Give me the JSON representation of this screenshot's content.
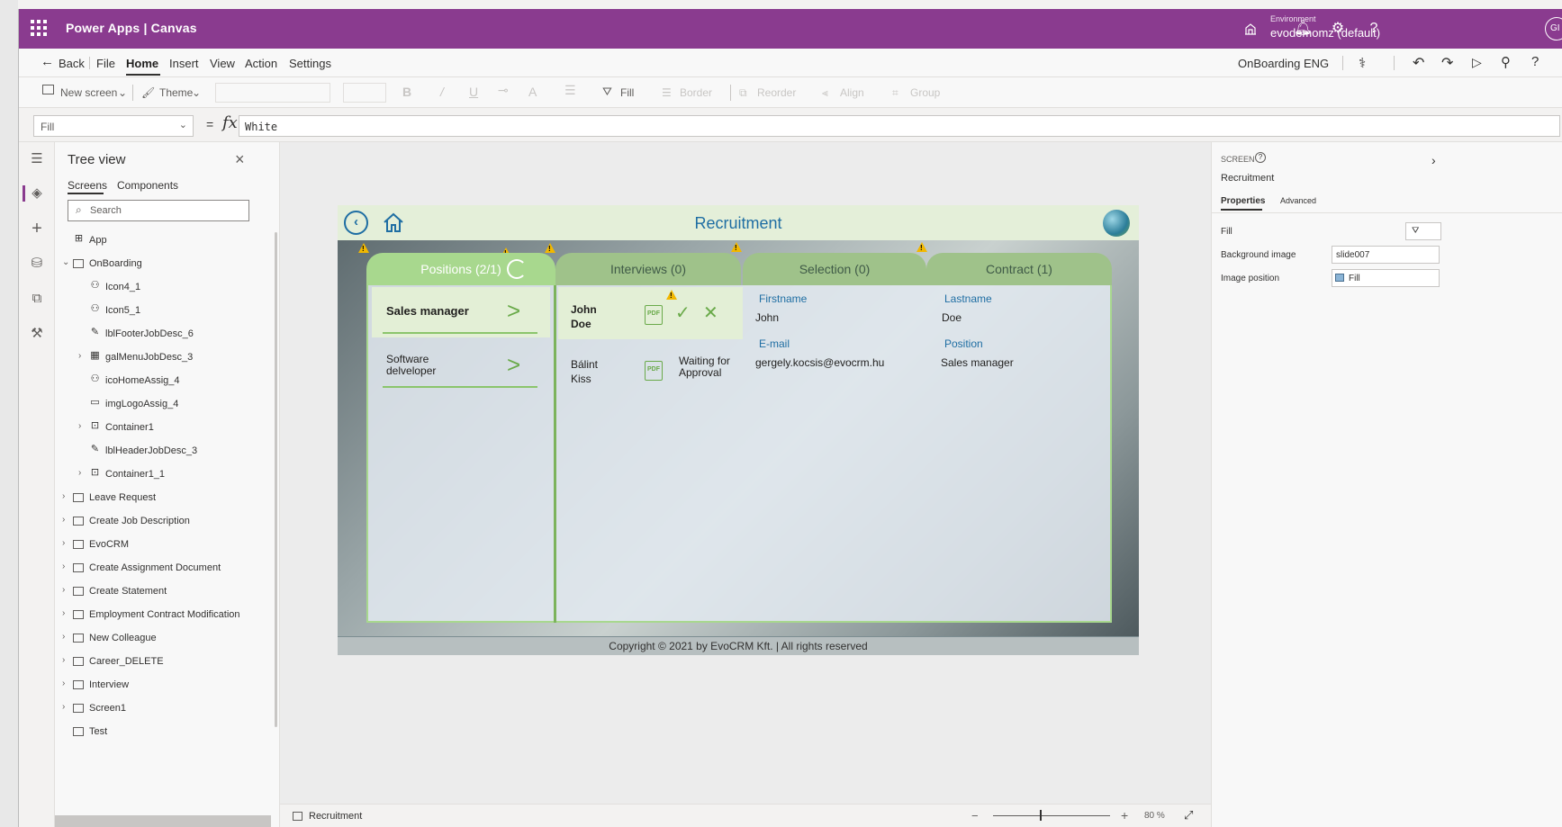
{
  "topbar": {
    "app_title": "Power Apps  |  Canvas",
    "environment_label": "Environment",
    "environment_value": "evodemomz (default)",
    "avatar_initials": "GI"
  },
  "menu": {
    "back": "Back",
    "items": [
      "File",
      "Home",
      "Insert",
      "View",
      "Action",
      "Settings"
    ],
    "app_name": "OnBoarding ENG"
  },
  "toolbar": {
    "new_screen": "New screen",
    "theme": "Theme",
    "fill": "Fill",
    "border": "Border",
    "reorder": "Reorder",
    "align": "Align",
    "group": "Group"
  },
  "formula": {
    "property": "Fill",
    "value": "White"
  },
  "tree": {
    "title": "Tree view",
    "tabs": [
      "Screens",
      "Components"
    ],
    "search_placeholder": "Search",
    "rows": [
      {
        "label": "App",
        "icon": "app-icon"
      },
      {
        "label": "OnBoarding",
        "icon": "screen-icon"
      },
      {
        "label": "Icon4_1",
        "icon": "icon-control-icon"
      },
      {
        "label": "Icon5_1",
        "icon": "icon-control-icon"
      },
      {
        "label": "lblFooterJobDesc_6",
        "icon": "label-icon"
      },
      {
        "label": "galMenuJobDesc_3",
        "icon": "gallery-icon"
      },
      {
        "label": "icoHomeAssig_4",
        "icon": "icon-control-icon"
      },
      {
        "label": "imgLogoAssig_4",
        "icon": "image-icon"
      },
      {
        "label": "Container1",
        "icon": "container-icon"
      },
      {
        "label": "lblHeaderJobDesc_3",
        "icon": "label-icon"
      },
      {
        "label": "Container1_1",
        "icon": "container-icon"
      },
      {
        "label": "Leave Request",
        "icon": "screen-icon"
      },
      {
        "label": "Create Job Description",
        "icon": "screen-icon"
      },
      {
        "label": "EvoCRM",
        "icon": "screen-icon"
      },
      {
        "label": "Create Assignment Document",
        "icon": "screen-icon"
      },
      {
        "label": "Create Statement",
        "icon": "screen-icon"
      },
      {
        "label": "Employment Contract Modification",
        "icon": "screen-icon"
      },
      {
        "label": "New Colleague",
        "icon": "screen-icon"
      },
      {
        "label": "Career_DELETE",
        "icon": "screen-icon"
      },
      {
        "label": "Interview",
        "icon": "screen-icon"
      },
      {
        "label": "Screen1",
        "icon": "screen-icon"
      },
      {
        "label": "Test",
        "icon": "screen-icon"
      }
    ]
  },
  "app_screen": {
    "title": "Recruitment",
    "tabs": [
      "Positions (2/1)",
      "Interviews (0)",
      "Selection (0)",
      "Contract (1)"
    ],
    "positions": [
      "Sales manager",
      "Software delveloper"
    ],
    "candidates": [
      {
        "name": "John Doe",
        "status": ""
      },
      {
        "name": "Bálint Kiss",
        "status": "Waiting for Approval"
      }
    ],
    "pdf_label": "PDF",
    "fields": {
      "firstname_label": "Firstname",
      "firstname": "John",
      "lastname_label": "Lastname",
      "lastname": "Doe",
      "email_label": "E-mail",
      "email": "gergely.kocsis@evocrm.hu",
      "position_label": "Position",
      "position": "Sales manager"
    },
    "footer": "Copyright © 2021 by EvoCRM Kft. | All rights reserved"
  },
  "statusbar": {
    "screen_name": "Recruitment",
    "zoom": "80 %",
    "zoom_percent": 80
  },
  "right_panel": {
    "kind": "SCREEN",
    "name": "Recruitment",
    "tabs": [
      "Properties",
      "Advanced"
    ],
    "fill_label": "Fill",
    "bg_image_label": "Background image",
    "bg_image_value": "slide007",
    "img_position_label": "Image position",
    "img_position_value": "Fill"
  }
}
